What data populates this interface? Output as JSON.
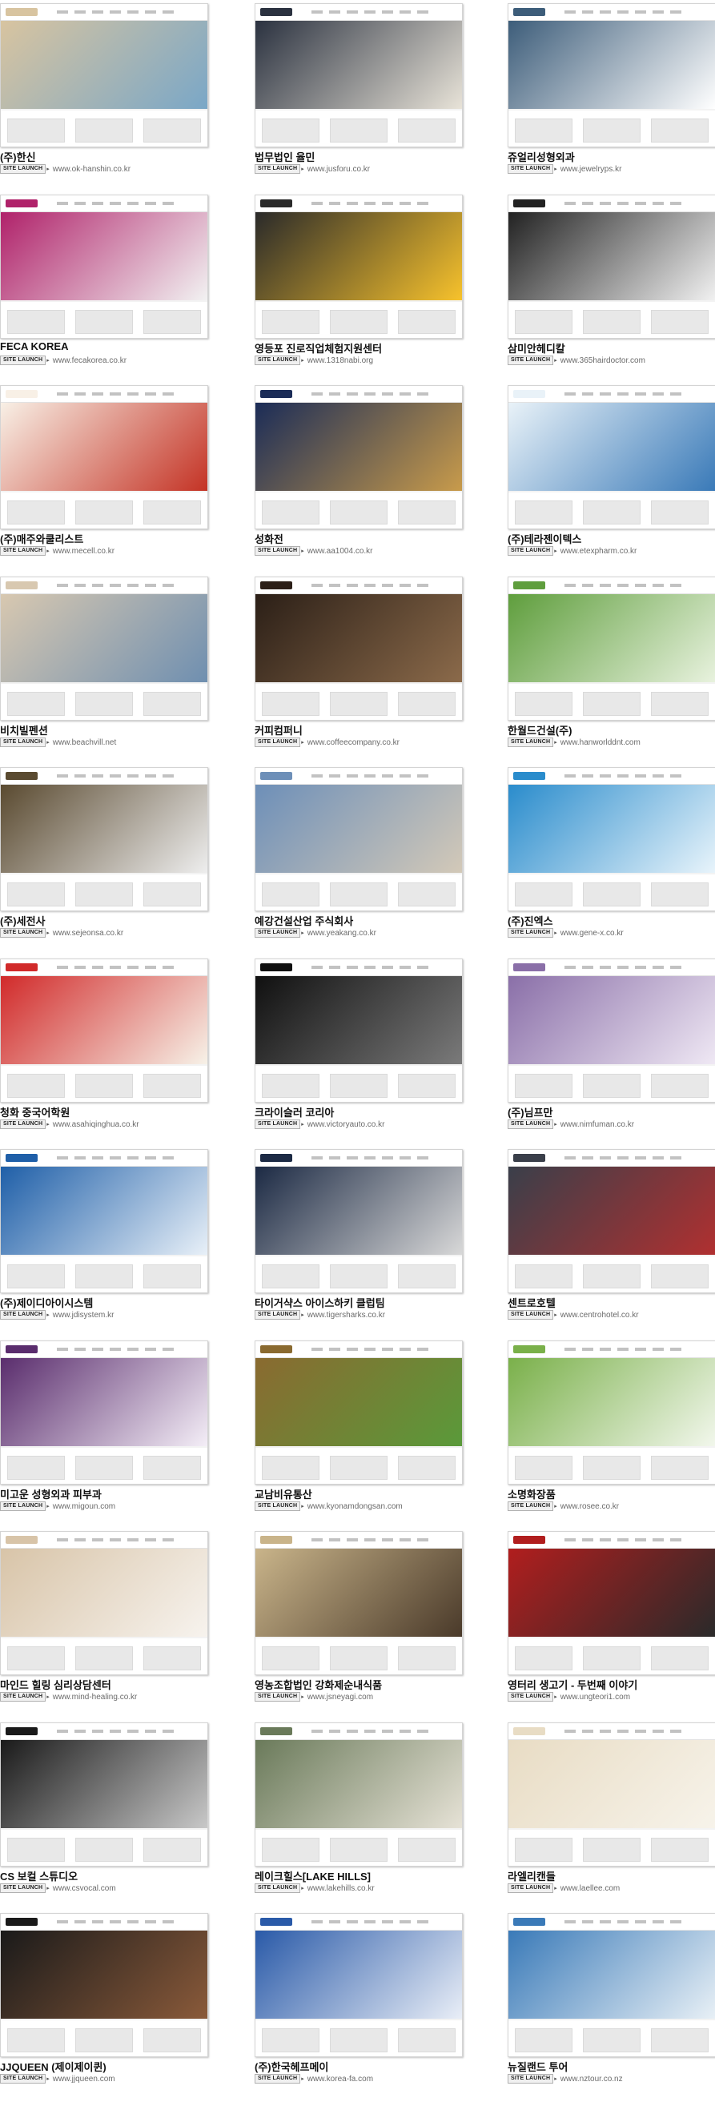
{
  "badge_label": "SITE LAUNCH",
  "sites": [
    {
      "title": "(주)한신",
      "url": "www.ok-hanshin.co.kr",
      "colors": [
        "#d8c4a0",
        "#7aa7c7"
      ]
    },
    {
      "title": "법무법인 율민",
      "url": "www.jusforu.co.kr",
      "colors": [
        "#2b3240",
        "#e8e3d8"
      ]
    },
    {
      "title": "쥬얼리성형외과",
      "url": "www.jewelryps.kr",
      "colors": [
        "#3d5d7a",
        "#ffffff"
      ]
    },
    {
      "title": "FECA KOREA",
      "url": "www.fecakorea.co.kr",
      "colors": [
        "#b0226a",
        "#f2f2f2"
      ]
    },
    {
      "title": "영등포 진로직업체험지원센터",
      "url": "www.1318nabi.org",
      "colors": [
        "#2a2a2a",
        "#f7c22c"
      ]
    },
    {
      "title": "삼미안헤디칼",
      "url": "www.365hairdoctor.com",
      "colors": [
        "#222222",
        "#f1f1f1"
      ]
    },
    {
      "title": "(주)매주와쿨리스트",
      "url": "www.mecell.co.kr",
      "colors": [
        "#f8f0e6",
        "#c43325"
      ]
    },
    {
      "title": "성화전",
      "url": "www.aa1004.co.kr",
      "colors": [
        "#1b2c57",
        "#c89b4b"
      ]
    },
    {
      "title": "(주)테라젠이텍스",
      "url": "www.etexpharm.co.kr",
      "colors": [
        "#e9f2f8",
        "#3a7ab8"
      ]
    },
    {
      "title": "비치빌펜션",
      "url": "www.beachvill.net",
      "colors": [
        "#d8c8b0",
        "#6f8fb0"
      ]
    },
    {
      "title": "커피컴퍼니",
      "url": "www.coffeecompany.co.kr",
      "colors": [
        "#2b1f17",
        "#8b6a4a"
      ]
    },
    {
      "title": "한월드건설(주)",
      "url": "www.hanworlddnt.com",
      "colors": [
        "#5f9e3d",
        "#e8f2de"
      ]
    },
    {
      "title": "(주)세전사",
      "url": "www.sejeonsa.co.kr",
      "colors": [
        "#5a4a30",
        "#eeeeee"
      ]
    },
    {
      "title": "예강건설산업 주식회사",
      "url": "www.yeakang.co.kr",
      "colors": [
        "#6d8fb8",
        "#d3c9b8"
      ]
    },
    {
      "title": "(주)진엑스",
      "url": "www.gene-x.co.kr",
      "colors": [
        "#2a8ccc",
        "#e8f4fb"
      ]
    },
    {
      "title": "청화 중국어학원",
      "url": "www.asahiqinghua.co.kr",
      "colors": [
        "#d12a2a",
        "#f7f2e8"
      ]
    },
    {
      "title": "크라이슬러 코리아",
      "url": "www.victoryauto.co.kr",
      "colors": [
        "#101010",
        "#7a7a7a"
      ]
    },
    {
      "title": "(주)님프만",
      "url": "www.nimfuman.co.kr",
      "colors": [
        "#8a6fa8",
        "#efe8f4"
      ]
    },
    {
      "title": "(주)제이디아이시스템",
      "url": "www.jdisystem.kr",
      "colors": [
        "#1f5fa8",
        "#e8f0f8"
      ]
    },
    {
      "title": "타이거샥스 아이스하키 클럽팀",
      "url": "www.tigersharks.co.kr",
      "colors": [
        "#1c2a44",
        "#d8d8d8"
      ]
    },
    {
      "title": "센트로호텔",
      "url": "www.centrohotel.co.kr",
      "colors": [
        "#3a3f4a",
        "#b03030"
      ]
    },
    {
      "title": "미고운 성형외과 피부과",
      "url": "www.migoun.com",
      "colors": [
        "#5a2d6d",
        "#f4eef7"
      ]
    },
    {
      "title": "교남비유통산",
      "url": "www.kyonamdongsan.com",
      "colors": [
        "#8a6a30",
        "#5a9a3a"
      ]
    },
    {
      "title": "소명화장품",
      "url": "www.rosee.co.kr",
      "colors": [
        "#7ab04a",
        "#f2f7ec"
      ]
    },
    {
      "title": "마인드 힐링 심리상담센터",
      "url": "www.mind-healing.co.kr",
      "colors": [
        "#d8c4a8",
        "#f7f3ee"
      ]
    },
    {
      "title": "영농조합법인 강화제순내식품",
      "url": "www.jsneyagi.com",
      "colors": [
        "#c9b48a",
        "#4a3a2a"
      ]
    },
    {
      "title": "영터리 생고기 - 두번째 이야기",
      "url": "www.ungteori1.com",
      "colors": [
        "#b11e1e",
        "#2a2a2a"
      ]
    },
    {
      "title": "CS 보컬 스튜디오",
      "url": "www.csvocal.com",
      "colors": [
        "#1a1a1a",
        "#c8c8c8"
      ]
    },
    {
      "title": "레이크힐스[LAKE HILLS]",
      "url": "www.lakehills.co.kr",
      "colors": [
        "#6a7a5a",
        "#e6e2d6"
      ]
    },
    {
      "title": "라엘리캔들",
      "url": "www.laellee.com",
      "colors": [
        "#e8dcc4",
        "#f7f3ea"
      ]
    },
    {
      "title": "JJQUEEN (제이제이퀸)",
      "url": "www.jjqueen.com",
      "colors": [
        "#1a1a1a",
        "#8a5a3a"
      ]
    },
    {
      "title": "(주)한국헤프메이",
      "url": "www.korea-fa.com",
      "colors": [
        "#2a5aa8",
        "#e9eef7"
      ]
    },
    {
      "title": "뉴질랜드 투어",
      "url": "www.nztour.co.nz",
      "colors": [
        "#3a7ab8",
        "#e8f0f6"
      ]
    }
  ]
}
